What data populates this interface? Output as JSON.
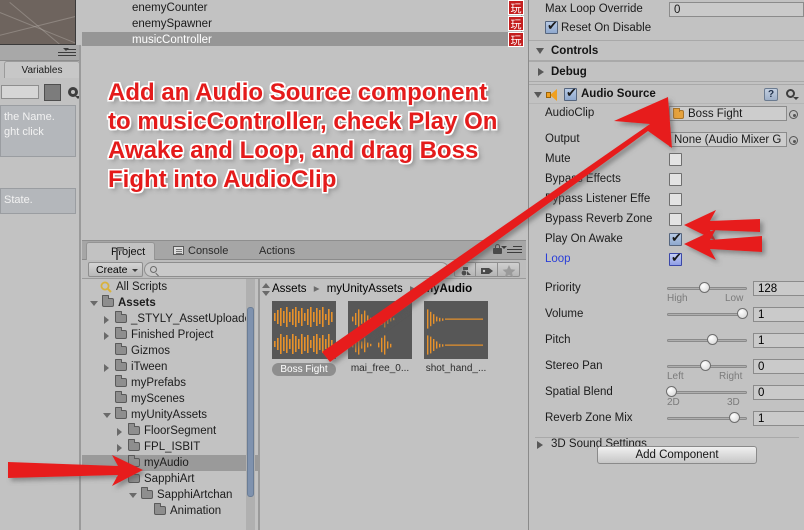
{
  "hierarchy": {
    "items": [
      {
        "label": "enemyCounter",
        "selected": false
      },
      {
        "label": "enemySpawner",
        "selected": false
      },
      {
        "label": "musicController",
        "selected": true
      }
    ]
  },
  "left_panel": {
    "tab_label": "Variables",
    "help_text_1": "the Name.",
    "help_text_2": "ght click",
    "help_text_3": "State."
  },
  "badges": [
    "玩",
    "玩",
    "玩"
  ],
  "instruction": {
    "text": "Add an Audio Source component to musicController, check Play On Awake and Loop, and drag Boss Fight into AudioClip",
    "color": "#e41b1b"
  },
  "project": {
    "tabs": [
      {
        "label": "Project",
        "icon": "folder-icon",
        "active": true
      },
      {
        "label": "Console",
        "icon": "document-icon",
        "active": false
      },
      {
        "label": "Actions",
        "icon": "none",
        "active": false
      }
    ],
    "toolbar": {
      "create_label": "Create",
      "search_placeholder": "",
      "search_value": "",
      "icons": [
        "asset-filter-icon",
        "label-filter-icon",
        "favorites-star-icon"
      ],
      "lock_icon": "lock-icon",
      "menu_icon": "hamburger-menu-icon"
    },
    "tree": [
      {
        "label": "All Scripts",
        "depth": 1,
        "arrow": "none",
        "icon": "search-saved-icon",
        "selected": false
      },
      {
        "label": "Assets",
        "depth": 0,
        "arrow": "open",
        "icon": "folder-icon",
        "bold": true,
        "selected": false
      },
      {
        "label": "_STYLY_AssetUploade",
        "depth": 1,
        "arrow": "closed",
        "icon": "folder-icon",
        "selected": false
      },
      {
        "label": "Finished Project",
        "depth": 1,
        "arrow": "closed",
        "icon": "folder-icon",
        "selected": false
      },
      {
        "label": "Gizmos",
        "depth": 1,
        "arrow": "none",
        "icon": "folder-icon",
        "selected": false
      },
      {
        "label": "iTween",
        "depth": 1,
        "arrow": "closed",
        "icon": "folder-icon",
        "selected": false
      },
      {
        "label": "myPrefabs",
        "depth": 1,
        "arrow": "none",
        "icon": "folder-icon",
        "selected": false
      },
      {
        "label": "myScenes",
        "depth": 1,
        "arrow": "none",
        "icon": "folder-icon",
        "selected": false
      },
      {
        "label": "myUnityAssets",
        "depth": 1,
        "arrow": "open",
        "icon": "folder-icon",
        "selected": false
      },
      {
        "label": "FloorSegment",
        "depth": 2,
        "arrow": "closed",
        "icon": "folder-icon",
        "selected": false
      },
      {
        "label": "FPL_ISBIT",
        "depth": 2,
        "arrow": "closed",
        "icon": "folder-icon",
        "selected": false
      },
      {
        "label": "myAudio",
        "depth": 2,
        "arrow": "none",
        "icon": "folder-icon",
        "selected": true
      },
      {
        "label": "SapphiArt",
        "depth": 2,
        "arrow": "open",
        "icon": "folder-icon",
        "selected": false
      },
      {
        "label": "SapphiArtchan",
        "depth": 3,
        "arrow": "open",
        "icon": "folder-icon",
        "selected": false
      },
      {
        "label": "Animation",
        "depth": 4,
        "arrow": "none",
        "icon": "folder-icon",
        "selected": false
      }
    ],
    "breadcrumb": [
      "Assets",
      "myUnityAssets",
      "myAudio"
    ],
    "assets": [
      {
        "name": "Boss Fight",
        "selected": true
      },
      {
        "name": "mai_free_0...",
        "selected": false
      },
      {
        "name": "shot_hand_...",
        "selected": false
      }
    ]
  },
  "inspector": {
    "top_rows": [
      {
        "label": "Max Loop Override",
        "type": "field",
        "value": "0"
      },
      {
        "label": "Reset On Disable",
        "type": "checkbox",
        "checked": true
      }
    ],
    "sections": [
      {
        "title": "Controls",
        "expanded": true
      },
      {
        "title": "Debug",
        "expanded": false
      }
    ],
    "audio_source": {
      "component_title": "Audio Source",
      "enabled": true,
      "icon": "speaker-icon",
      "help_icon": "help-icon",
      "settings_icon": "gear-icon",
      "audio_clip": {
        "label": "AudioClip",
        "value": "Boss Fight"
      },
      "output": {
        "label": "Output",
        "value": "None (Audio Mixer G"
      },
      "toggles": [
        {
          "label": "Mute",
          "checked": false,
          "blue": false
        },
        {
          "label": "Bypass Effects",
          "checked": false,
          "blue": false
        },
        {
          "label": "Bypass Listener Effe",
          "checked": false,
          "blue": false
        },
        {
          "label": "Bypass Reverb Zone",
          "checked": false,
          "blue": false
        },
        {
          "label": "Play On Awake",
          "checked": true,
          "blue": false
        },
        {
          "label": "Loop",
          "checked": true,
          "blue": true
        }
      ],
      "sliders": [
        {
          "label": "Priority",
          "value": "128",
          "pos": 0.47,
          "min_label": "High",
          "max_label": "Low"
        },
        {
          "label": "Volume",
          "value": "1",
          "pos": 1.0,
          "min_label": "",
          "max_label": ""
        },
        {
          "label": "Pitch",
          "value": "1",
          "pos": 0.55,
          "min_label": "",
          "max_label": ""
        },
        {
          "label": "Stereo Pan",
          "value": "0",
          "pos": 0.47,
          "min_label": "Left",
          "max_label": "Right"
        },
        {
          "label": "Spatial Blend",
          "value": "0",
          "pos": 0.0,
          "min_label": "2D",
          "max_label": "3D"
        },
        {
          "label": "Reverb Zone Mix",
          "value": "1",
          "pos": 0.87,
          "min_label": "",
          "max_label": ""
        }
      ],
      "sound_settings": {
        "title": "3D Sound Settings",
        "expanded": false
      }
    },
    "add_component_label": "Add Component"
  }
}
